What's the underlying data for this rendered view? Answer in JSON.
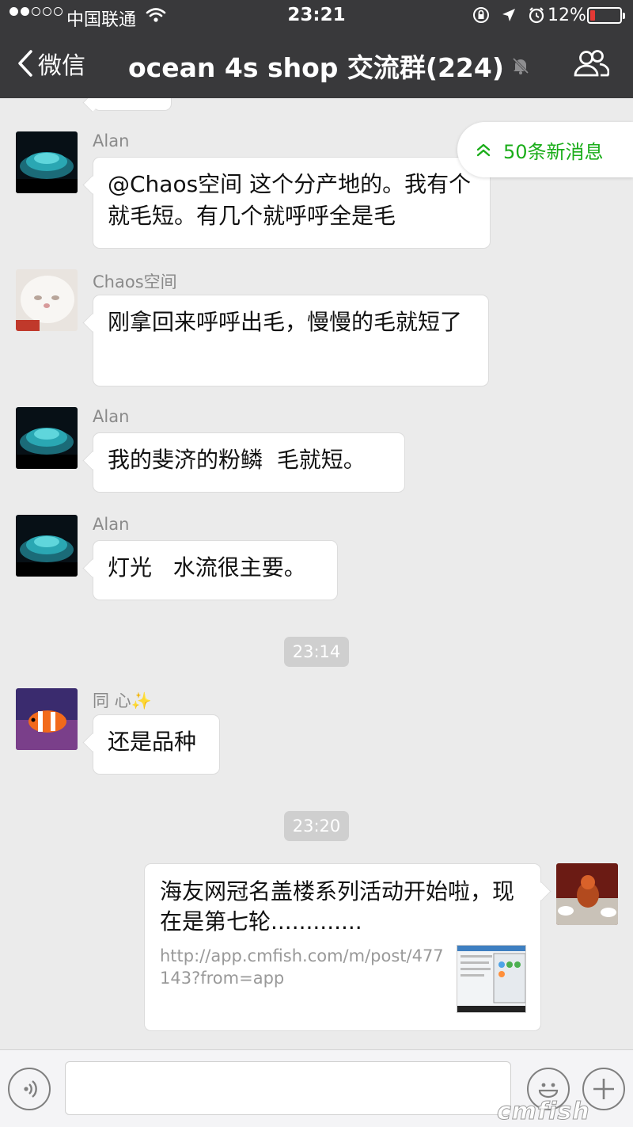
{
  "status_bar": {
    "carrier": "中国联通",
    "time": "23:21",
    "battery": "12%",
    "battery_level": 0.12,
    "signal_strength": 2
  },
  "nav": {
    "back_label": "微信",
    "title": "ocean 4s shop 交流群(224)"
  },
  "new_messages": {
    "label": "50条新消息"
  },
  "messages": [
    {
      "sender": "Alan",
      "text": "@Chaos空间 这个分产地的。我有个就毛短。有几个就呼呼全是毛"
    },
    {
      "sender": "Chaos空间",
      "text": "刚拿回来呼呼出毛，慢慢的毛就短了"
    },
    {
      "sender": "Alan",
      "text": "我的斐济的粉鳞  毛就短。"
    },
    {
      "sender": "Alan",
      "text": "灯光   水流很主要。"
    },
    {
      "timestamp": "23:14"
    },
    {
      "sender": "同 心✨",
      "text": "还是品种"
    },
    {
      "timestamp": "23:20"
    },
    {
      "self": true,
      "link_title": "海友网冠名盖楼系列活动开始啦，现在是第七轮.............",
      "link_url": "http://app.cmfish.com/m/post/477143?from=app"
    }
  ],
  "input_bar": {
    "placeholder": "",
    "watermark": "cmfish"
  },
  "colors": {
    "nav_bg": "#39393b",
    "chat_bg": "#ebebeb",
    "accent_green": "#1aad19",
    "battery_low": "#e53935"
  }
}
